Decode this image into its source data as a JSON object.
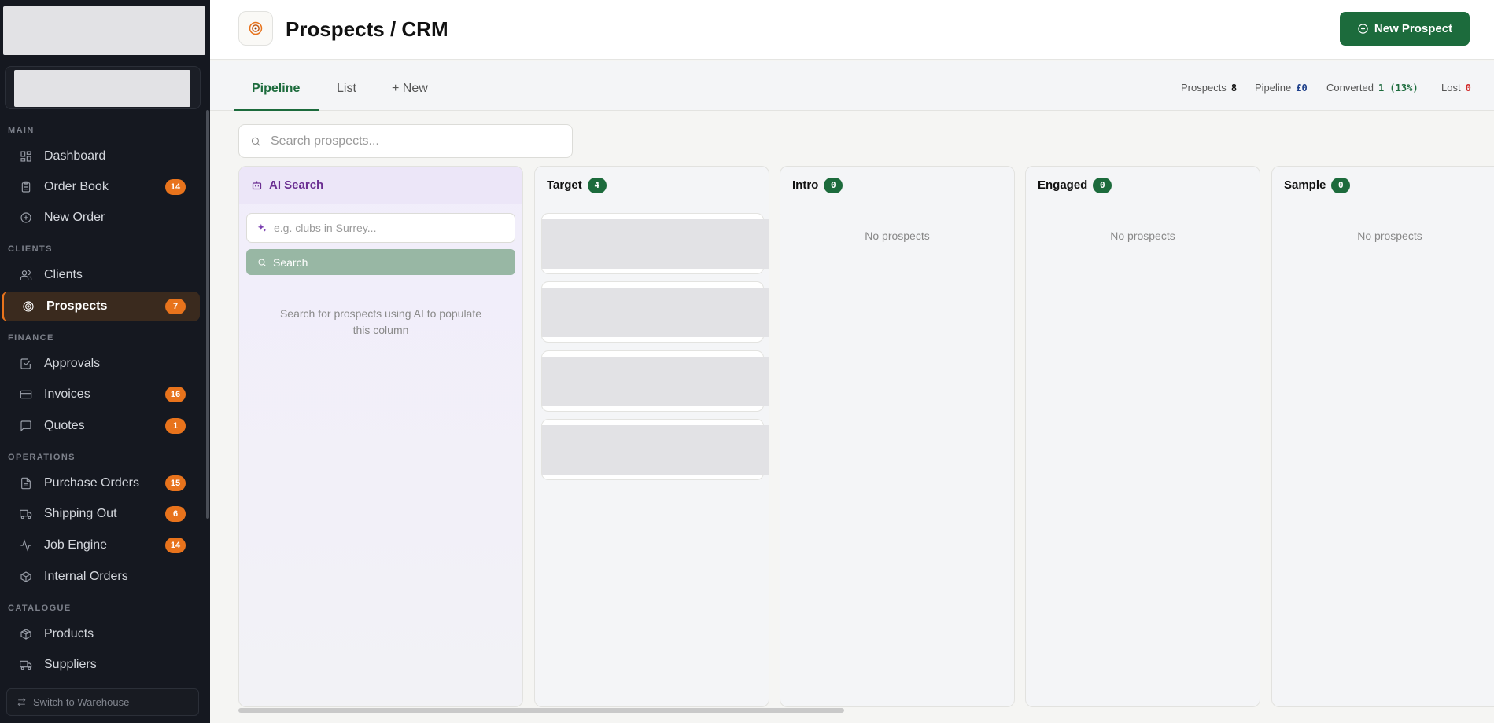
{
  "sidebar": {
    "sections": [
      {
        "label": "MAIN"
      },
      {
        "label": "CLIENTS"
      },
      {
        "label": "FINANCE"
      },
      {
        "label": "OPERATIONS"
      },
      {
        "label": "CATALOGUE"
      }
    ],
    "items": [
      {
        "label": "Dashboard",
        "icon": "dashboard-icon",
        "badge": ""
      },
      {
        "label": "Order Book",
        "icon": "clipboard-icon",
        "badge": "14"
      },
      {
        "label": "New Order",
        "icon": "plus-circle-icon",
        "badge": ""
      },
      {
        "label": "Clients",
        "icon": "users-icon",
        "badge": ""
      },
      {
        "label": "Prospects",
        "icon": "target-icon",
        "badge": "7",
        "active": true
      },
      {
        "label": "Approvals",
        "icon": "check-square-icon",
        "badge": ""
      },
      {
        "label": "Invoices",
        "icon": "credit-card-icon",
        "badge": "16"
      },
      {
        "label": "Quotes",
        "icon": "message-square-icon",
        "badge": "1"
      },
      {
        "label": "Purchase Orders",
        "icon": "file-text-icon",
        "badge": "15"
      },
      {
        "label": "Shipping Out",
        "icon": "truck-icon",
        "badge": "6"
      },
      {
        "label": "Job Engine",
        "icon": "activity-icon",
        "badge": "14"
      },
      {
        "label": "Internal Orders",
        "icon": "box-icon",
        "badge": ""
      },
      {
        "label": "Products",
        "icon": "package-icon",
        "badge": ""
      },
      {
        "label": "Suppliers",
        "icon": "truck-icon",
        "badge": ""
      }
    ],
    "warehouse_label": "Switch to Warehouse"
  },
  "header": {
    "title": "Prospects / CRM",
    "new_button": "New Prospect"
  },
  "tabs": [
    {
      "label": "Pipeline",
      "active": true
    },
    {
      "label": "List"
    },
    {
      "label": "+ New"
    }
  ],
  "stats": {
    "prospects_label": "Prospects",
    "prospects_value": "8",
    "pipeline_label": "Pipeline",
    "pipeline_value": "£0",
    "converted_label": "Converted",
    "converted_value": "1 (13%)",
    "lost_label": "Lost",
    "lost_value": "0"
  },
  "search": {
    "placeholder": "Search prospects..."
  },
  "ai_column": {
    "title": "AI Search",
    "input_placeholder": "e.g. clubs in Surrey...",
    "button_label": "Search",
    "hint": "Search for prospects using AI to populate this column"
  },
  "columns": [
    {
      "title": "Target",
      "count": "4",
      "empty_text": ""
    },
    {
      "title": "Intro",
      "count": "0",
      "empty_text": "No prospects"
    },
    {
      "title": "Engaged",
      "count": "0",
      "empty_text": "No prospects"
    },
    {
      "title": "Sample",
      "count": "0",
      "empty_text": "No prospects"
    }
  ],
  "colors": {
    "accent_green": "#1c6b3c",
    "badge_orange": "#e8731c",
    "ai_purple": "#6b2f92",
    "sidebar_bg": "#151820",
    "lost_red": "#d12a2a",
    "pipeline_blue": "#1d3f8a"
  }
}
